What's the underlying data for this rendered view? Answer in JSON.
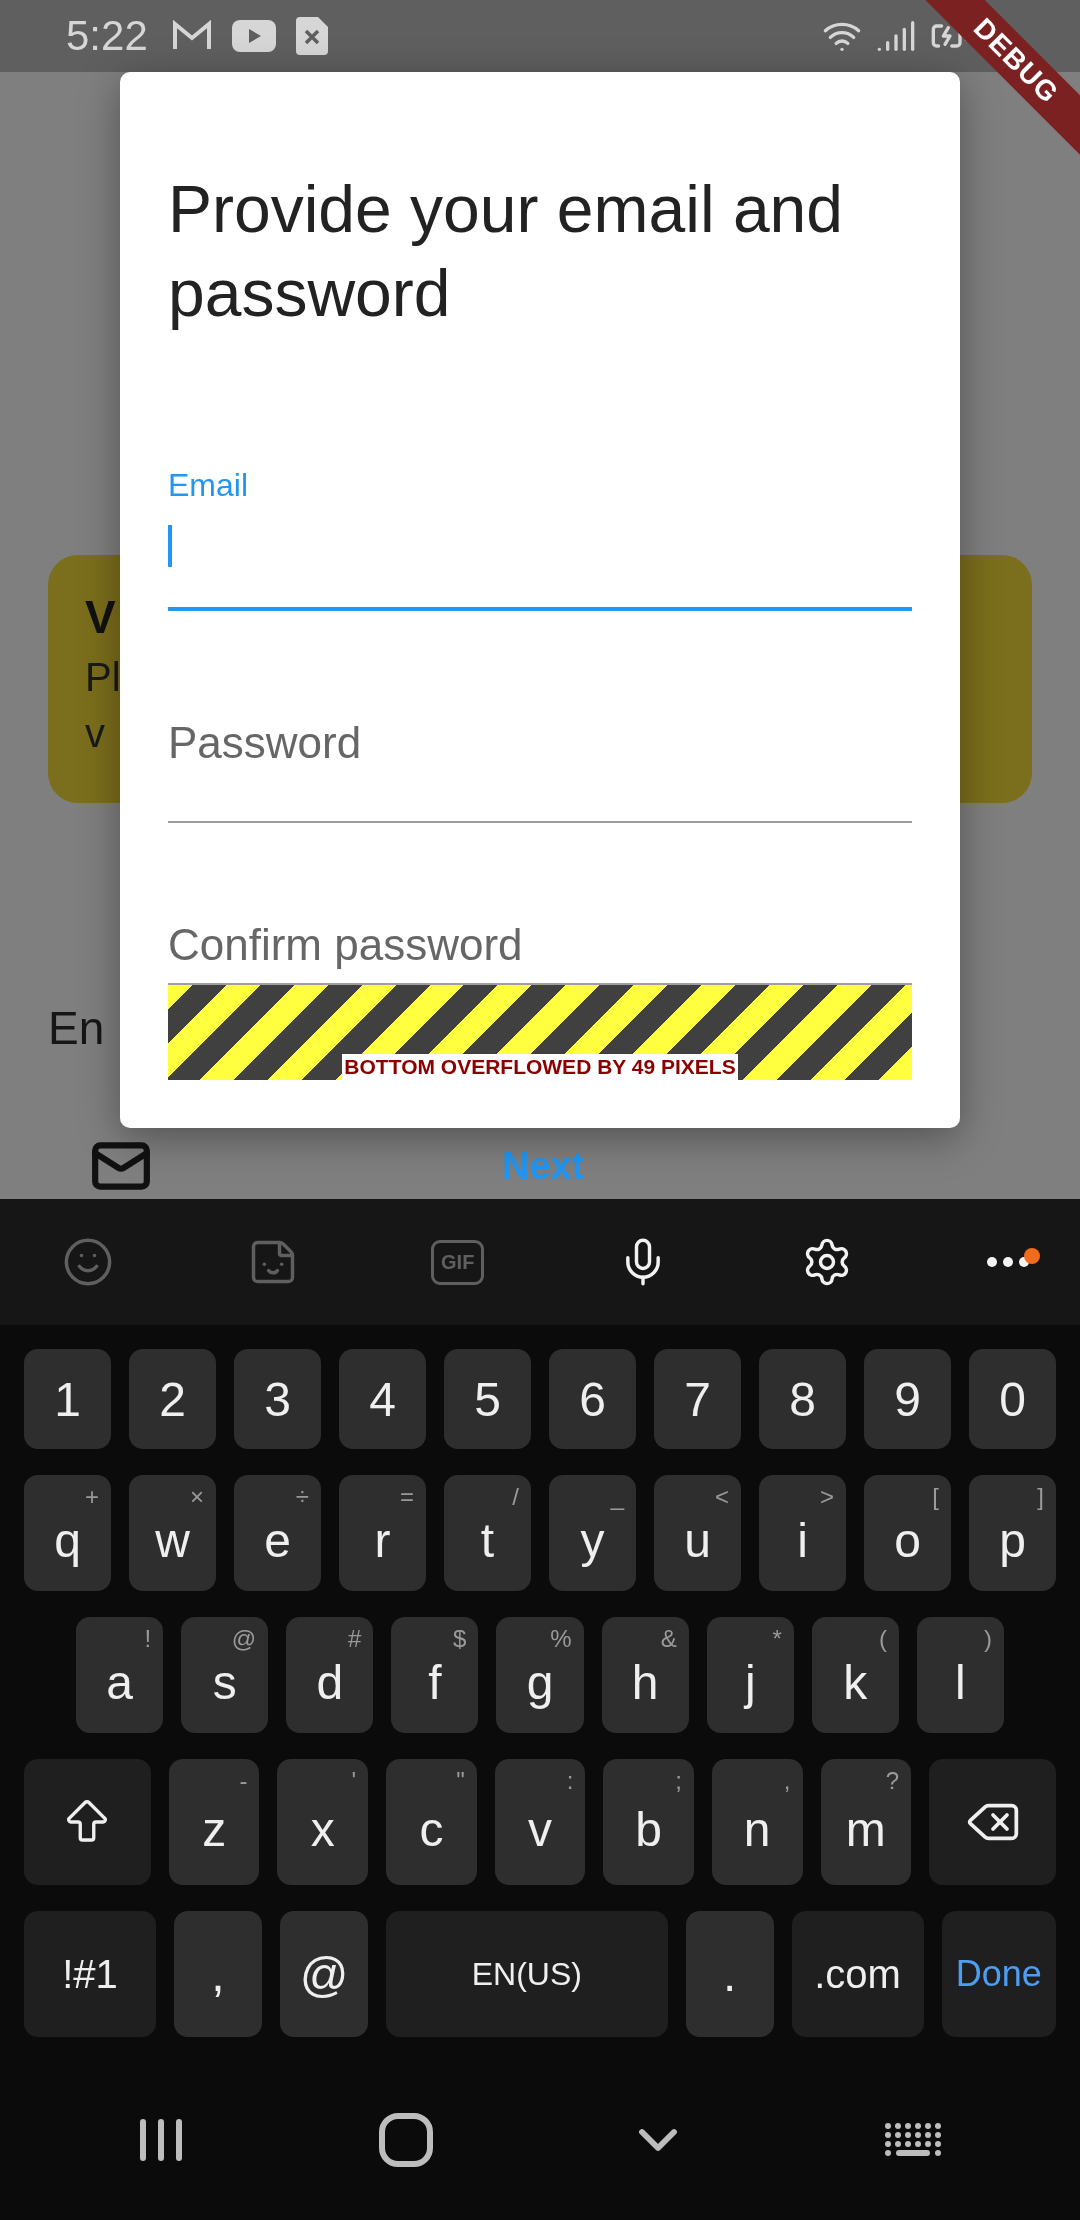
{
  "status_bar": {
    "time": "5:22"
  },
  "debug_banner": {
    "text": "DEBUG"
  },
  "background": {
    "card": {
      "title": "V",
      "lines": [
        "Pl",
        "v"
      ]
    },
    "label": "En",
    "next_button": "Next"
  },
  "dialog": {
    "title": "Provide your email and password",
    "fields": [
      {
        "label": "Email",
        "focused": true
      },
      {
        "label": "Password",
        "focused": false
      },
      {
        "label": "Confirm password",
        "focused": false
      }
    ],
    "overflow_warning": "BOTTOM OVERFLOWED BY 49 PIXELS"
  },
  "keyboard": {
    "toolbar": [
      {
        "kind": "emoji",
        "disabled": true
      },
      {
        "kind": "sticker",
        "disabled": true
      },
      {
        "kind": "gif",
        "label": "GIF",
        "disabled": true
      },
      {
        "kind": "voice",
        "disabled": false
      },
      {
        "kind": "settings",
        "disabled": false
      },
      {
        "kind": "more",
        "disabled": false,
        "badge": true
      }
    ],
    "rows": [
      {
        "keys": [
          {
            "kind": "char",
            "label": "1"
          },
          {
            "kind": "char",
            "label": "2"
          },
          {
            "kind": "char",
            "label": "3"
          },
          {
            "kind": "char",
            "label": "4"
          },
          {
            "kind": "char",
            "label": "5"
          },
          {
            "kind": "char",
            "label": "6"
          },
          {
            "kind": "char",
            "label": "7"
          },
          {
            "kind": "char",
            "label": "8"
          },
          {
            "kind": "char",
            "label": "9"
          },
          {
            "kind": "char",
            "label": "0"
          }
        ]
      },
      {
        "keys": [
          {
            "kind": "char",
            "label": "q",
            "hint": "+"
          },
          {
            "kind": "char",
            "label": "w",
            "hint": "×"
          },
          {
            "kind": "char",
            "label": "e",
            "hint": "÷"
          },
          {
            "kind": "char",
            "label": "r",
            "hint": "="
          },
          {
            "kind": "char",
            "label": "t",
            "hint": "/"
          },
          {
            "kind": "char",
            "label": "y",
            "hint": "_"
          },
          {
            "kind": "char",
            "label": "u",
            "hint": "<"
          },
          {
            "kind": "char",
            "label": "i",
            "hint": ">"
          },
          {
            "kind": "char",
            "label": "o",
            "hint": "["
          },
          {
            "kind": "char",
            "label": "p",
            "hint": "]"
          }
        ]
      },
      {
        "keys": [
          {
            "kind": "char",
            "label": "a",
            "hint": "!"
          },
          {
            "kind": "char",
            "label": "s",
            "hint": "@"
          },
          {
            "kind": "char",
            "label": "d",
            "hint": "#"
          },
          {
            "kind": "char",
            "label": "f",
            "hint": "$"
          },
          {
            "kind": "char",
            "label": "g",
            "hint": "%"
          },
          {
            "kind": "char",
            "label": "h",
            "hint": "&"
          },
          {
            "kind": "char",
            "label": "j",
            "hint": "*"
          },
          {
            "kind": "char",
            "label": "k",
            "hint": "("
          },
          {
            "kind": "char",
            "label": "l",
            "hint": ")"
          }
        ]
      },
      {
        "keys": [
          {
            "kind": "shift"
          },
          {
            "kind": "char",
            "label": "z",
            "hint": "-"
          },
          {
            "kind": "char",
            "label": "x",
            "hint": "'"
          },
          {
            "kind": "char",
            "label": "c",
            "hint": "\""
          },
          {
            "kind": "char",
            "label": "v",
            "hint": ":"
          },
          {
            "kind": "char",
            "label": "b",
            "hint": ";"
          },
          {
            "kind": "char",
            "label": "n",
            "hint": ","
          },
          {
            "kind": "char",
            "label": "m",
            "hint": "?"
          },
          {
            "kind": "backspace"
          }
        ]
      },
      {
        "keys": [
          {
            "kind": "mod",
            "label": "!#1"
          },
          {
            "kind": "char",
            "label": ","
          },
          {
            "kind": "char",
            "label": "@"
          },
          {
            "kind": "space",
            "label": "EN(US)"
          },
          {
            "kind": "char",
            "label": "."
          },
          {
            "kind": "mod",
            "label": ".com"
          },
          {
            "kind": "done",
            "label": "Done"
          }
        ]
      }
    ]
  }
}
